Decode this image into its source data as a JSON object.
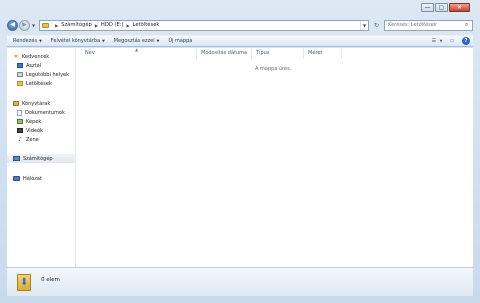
{
  "window": {
    "caption_buttons": {
      "minimize": "—",
      "maximize": "▢",
      "close": "✕"
    }
  },
  "address": {
    "crumbs": [
      "Számítógép",
      "HDD (E:)",
      "Letöltések"
    ],
    "search_placeholder": "Keresés: Letöltések"
  },
  "toolbar": {
    "organize": "Rendezés",
    "add_to_library": "Felvétel könyvtárba",
    "share_with": "Megosztás ezzel",
    "new_folder": "Új mappa"
  },
  "nav": {
    "favorites": {
      "label": "Kedvencek",
      "items": [
        "Asztal",
        "Legutóbbi helyek",
        "Letöltések"
      ]
    },
    "libraries": {
      "label": "Könyvtárak",
      "items": [
        "Dokumentumok",
        "Képek",
        "Videók",
        "Zene"
      ]
    },
    "computer": {
      "label": "Számítógép"
    },
    "network": {
      "label": "Hálózat"
    }
  },
  "columns": [
    "Név",
    "Módosítás dátuma",
    "Típus",
    "Méret"
  ],
  "empty_message": "A mappa üres.",
  "details": {
    "item_count": "0 elem"
  }
}
